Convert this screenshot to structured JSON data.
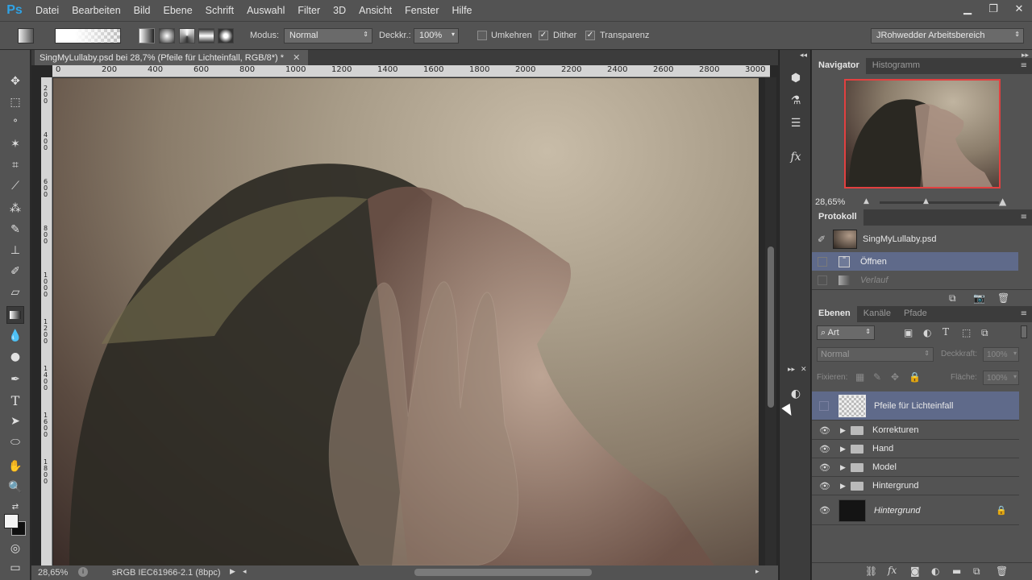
{
  "app": {
    "logo": "Ps",
    "menu": [
      "Datei",
      "Bearbeiten",
      "Bild",
      "Ebene",
      "Schrift",
      "Auswahl",
      "Filter",
      "3D",
      "Ansicht",
      "Fenster",
      "Hilfe"
    ],
    "window_controls": [
      "minimize-icon",
      "restore-icon",
      "close-icon"
    ]
  },
  "options": {
    "modus_label": "Modus:",
    "modus_value": "Normal",
    "deckkr_label": "Deckkr.:",
    "deckkr_value": "100%",
    "umkehren_label": "Umkehren",
    "umkehren_checked": false,
    "dither_label": "Dither",
    "dither_checked": true,
    "transparenz_label": "Transparenz",
    "transparenz_checked": true,
    "workspace": "JRohwedder Arbeitsbereich"
  },
  "document": {
    "tab_title": "SingMyLullaby.psd bei 28,7% (Pfeile für Lichteinfall, RGB/8*) *",
    "ruler_h": [
      "0",
      "200",
      "400",
      "600",
      "800",
      "1000",
      "1200",
      "1400",
      "1600",
      "1800",
      "2000",
      "2200",
      "2400",
      "2600",
      "2800",
      "3000"
    ],
    "ruler_v": [
      "2\n0\n0",
      "4\n0\n0",
      "6\n0\n0",
      "8\n0\n0",
      "1\n0\n0\n0",
      "1\n2\n0\n0",
      "1\n4\n0\n0",
      "1\n6\n0\n0",
      "1\n8\n0\n0"
    ],
    "zoom": "28,65%",
    "profile": "sRGB IEC61966-2.1 (8bpc)"
  },
  "navigator": {
    "tabs": [
      "Navigator",
      "Histogramm"
    ],
    "zoom": "28,65%"
  },
  "protokoll": {
    "title": "Protokoll",
    "snapshot": "SingMyLullaby.psd",
    "items": [
      "Öffnen",
      "Verlauf"
    ]
  },
  "layers": {
    "tabs": [
      "Ebenen",
      "Kanäle",
      "Pfade"
    ],
    "filter_kind": "Art",
    "blend_mode": "Normal",
    "opacity_label": "Deckkraft:",
    "opacity_value": "100%",
    "lock_label": "Fixieren:",
    "fill_label": "Fläche:",
    "fill_value": "100%",
    "rows": [
      {
        "name": "Pfeile für Lichteinfall",
        "type": "layer",
        "visible": false,
        "selected": true
      },
      {
        "name": "Korrekturen",
        "type": "group",
        "visible": true
      },
      {
        "name": "Hand",
        "type": "group",
        "visible": true
      },
      {
        "name": "Model",
        "type": "group",
        "visible": true
      },
      {
        "name": "Hintergrund",
        "type": "group",
        "visible": true
      },
      {
        "name": "Hintergrund",
        "type": "background",
        "visible": true,
        "locked": true
      }
    ]
  },
  "colors": {
    "accent_ps": "#2fa3e6",
    "selected_row": "#5f6a8a",
    "navigator_frame": "#e24040"
  }
}
